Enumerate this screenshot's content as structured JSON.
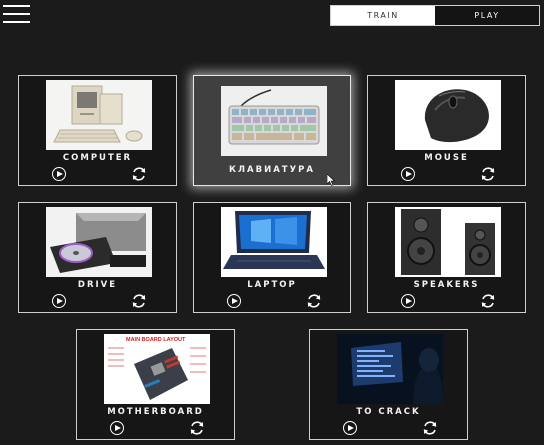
{
  "header": {
    "mode_train": "TRAIN",
    "mode_play": "PLAY"
  },
  "cards": [
    {
      "label": "COMPUTER",
      "image": "retro-computer-photo"
    },
    {
      "label": "КЛАВИАТУРА",
      "image": "keyboard-photo"
    },
    {
      "label": "MOUSE",
      "image": "mouse-photo"
    },
    {
      "label": "DRIVE",
      "image": "optical-drive-photo"
    },
    {
      "label": "LAPTOP",
      "image": "laptop-photo"
    },
    {
      "label": "SPEAKERS",
      "image": "speakers-photo"
    },
    {
      "label": "MOTHERBOARD",
      "image": "motherboard-photo",
      "image_text": "MAIN BOARD LAYOUT"
    },
    {
      "label": "TO CRACK",
      "image": "hacker-screen-photo"
    }
  ],
  "icons": {
    "menu": "hamburger-menu-icon",
    "play": "play-icon",
    "reload": "reload-icon"
  }
}
